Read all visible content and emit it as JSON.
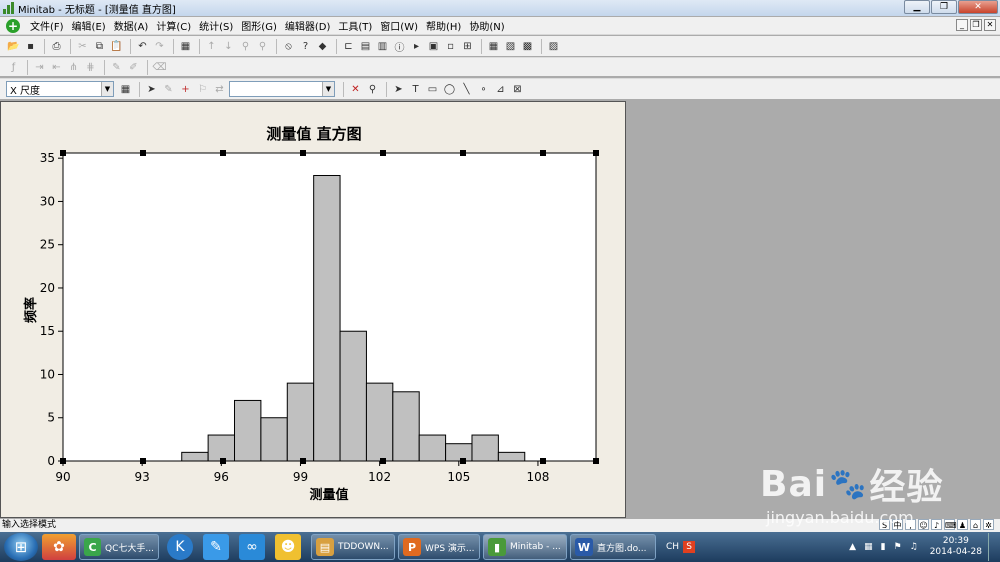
{
  "window": {
    "title": "Minitab - 无标题 - [测量值 直方图]"
  },
  "menubar": {
    "items": [
      "文件(F)",
      "编辑(E)",
      "数据(A)",
      "计算(C)",
      "统计(S)",
      "图形(G)",
      "编辑器(D)",
      "工具(T)",
      "窗口(W)",
      "帮助(H)",
      "协助(N)"
    ]
  },
  "toolbar3": {
    "scale_select": "X 尺度",
    "font_select": ""
  },
  "chart_data": {
    "type": "bar",
    "title": "测量值 直方图",
    "xlabel": "测量值",
    "ylabel": "频率",
    "xlim": [
      90,
      110.2
    ],
    "ylim": [
      0,
      35.6
    ],
    "x_ticks": [
      90,
      93,
      96,
      99,
      102,
      105,
      108
    ],
    "y_ticks": [
      0,
      5,
      10,
      15,
      20,
      25,
      30,
      35
    ],
    "bin_width": 1,
    "bins": [
      {
        "start": 94.5,
        "count": 1
      },
      {
        "start": 95.5,
        "count": 3
      },
      {
        "start": 96.5,
        "count": 7
      },
      {
        "start": 97.5,
        "count": 5
      },
      {
        "start": 98.5,
        "count": 9
      },
      {
        "start": 99.5,
        "count": 33
      },
      {
        "start": 100.5,
        "count": 15
      },
      {
        "start": 101.5,
        "count": 9
      },
      {
        "start": 102.5,
        "count": 8
      },
      {
        "start": 103.5,
        "count": 3
      },
      {
        "start": 104.5,
        "count": 2
      },
      {
        "start": 105.5,
        "count": 3
      },
      {
        "start": 106.5,
        "count": 1
      }
    ],
    "bar_color": "#c0c0c0",
    "background": "#ffffff"
  },
  "statusbar": {
    "text": "输入选择模式"
  },
  "taskbar": {
    "apps": [
      {
        "label": "QC七大手...",
        "icon": "C",
        "color": "#3aa64a"
      },
      {
        "label": "TDDOWN...",
        "icon": "▤",
        "color": "#d8a040"
      },
      {
        "label": "WPS 演示...",
        "icon": "P",
        "color": "#e06a20"
      },
      {
        "label": "Minitab - ...",
        "icon": "▮",
        "color": "#4a9a3a"
      },
      {
        "label": "直方图.do...",
        "icon": "W",
        "color": "#2a5aa8"
      }
    ],
    "lang": "CH",
    "time": "20:39",
    "date": "2014-04-28"
  },
  "watermark": {
    "logo_left": "Bai",
    "logo_right": "经验",
    "url": "jingyan.baidu.com"
  }
}
